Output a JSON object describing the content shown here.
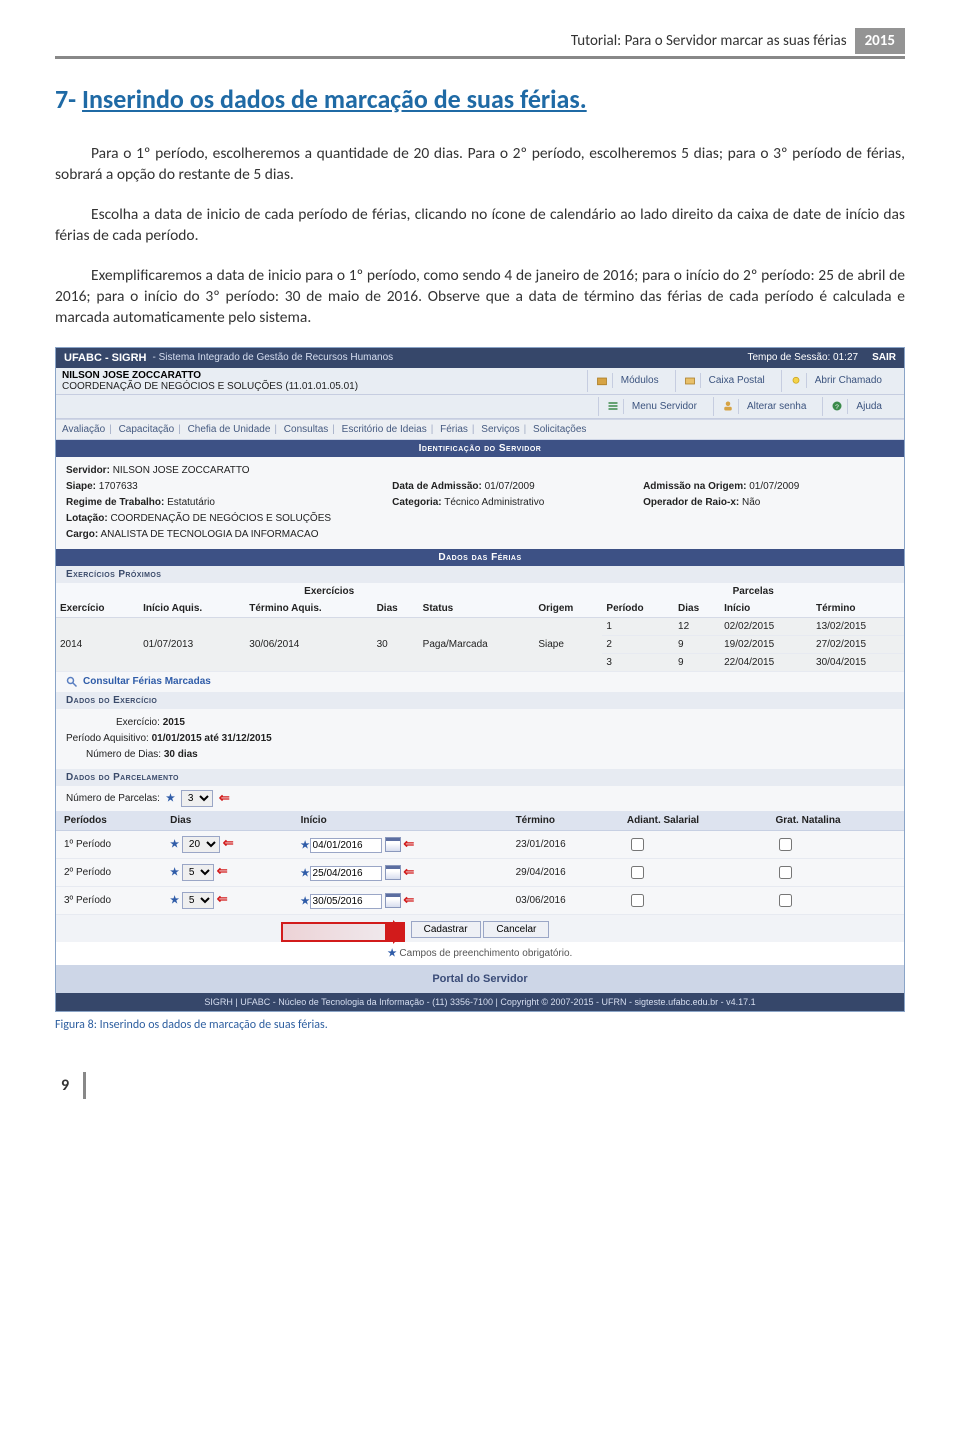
{
  "doc": {
    "header_title": "Tutorial: Para o Servidor marcar as suas férias",
    "header_year": "2015",
    "section_num": "7-",
    "section_title": "Inserindo os dados de marcação de suas férias.",
    "p1": "Para o 1º período, escolheremos a quantidade de 20 dias. Para o 2º período, escolheremos 5 dias; para o 3º período de férias, sobrará a opção do restante de 5 dias.",
    "p2": "Escolha a data de inicio de cada período de férias, clicando no ícone de calendário ao lado direito da caixa de date de início das férias de cada período.",
    "p3": "Exemplificaremos a data de inicio para o 1º período, como sendo 4 de janeiro de 2016; para o início do 2º período: 25 de abril de 2016; para o início do 3º período: 30 de maio de 2016. Observe que a data de término das férias de cada período é calculada e marcada automaticamente pelo sistema.",
    "caption": "Figura 8:  Inserindo os dados de marcação de suas férias.",
    "pagenum": "9"
  },
  "app": {
    "brand": "UFABC - SIGRH",
    "brand_sub": "- Sistema Integrado de Gestão de Recursos Humanos",
    "session": "Tempo de Sessão: 01:27",
    "sair": "SAIR",
    "user_name": "NILSON JOSE ZOCCARATTO",
    "user_unit": "COORDENAÇÃO DE NEGÓCIOS E SOLUÇÕES (11.01.01.05.01)",
    "toplinks": {
      "modulos": "Módulos",
      "caixa": "Caixa Postal",
      "abrir": "Abrir Chamado",
      "menu": "Menu Servidor",
      "alterar": "Alterar senha",
      "ajuda": "Ajuda"
    },
    "menu": {
      "avaliacao": "Avaliação",
      "capac": "Capacitação",
      "chefia": "Chefia de Unidade",
      "consultas": "Consultas",
      "escritorio": "Escritório de Ideias",
      "ferias": "Férias",
      "servicos": "Serviços",
      "solic": "Solicitações"
    },
    "band1": "Identificação do Servidor",
    "ident": {
      "servidor_l": "Servidor:",
      "servidor_v": "NILSON JOSE ZOCCARATTO",
      "siape_l": "Siape:",
      "siape_v": "1707633",
      "adm_l": "Data de Admissão:",
      "adm_v": "01/07/2009",
      "admorig_l": "Admissão na Origem:",
      "admorig_v": "01/07/2009",
      "regime_l": "Regime de Trabalho:",
      "regime_v": "Estatutário",
      "cat_l": "Categoria:",
      "cat_v": "Técnico Administrativo",
      "raio_l": "Operador de Raio-x:",
      "raio_v": "Não",
      "lot_l": "Lotação:",
      "lot_v": "COORDENAÇÃO DE NEGÓCIOS E SOLUÇÕES",
      "cargo_l": "Cargo:",
      "cargo_v": "ANALISTA DE TECNOLOGIA DA INFORMACAO"
    },
    "band2": "Dados das Férias",
    "sub_ex": "Exercícios Próximos",
    "th": {
      "grupo1": "Exercícios",
      "grupo2": "Parcelas",
      "exerc": "Exercício",
      "ini": "Início Aquis.",
      "term": "Término Aquis.",
      "dias": "Dias",
      "status": "Status",
      "origem": "Origem",
      "periodo": "Período",
      "pdias": "Dias",
      "pinicio": "Início",
      "ptermino": "Término"
    },
    "ex2014": {
      "exerc": "2014",
      "ini": "01/07/2013",
      "term": "30/06/2014",
      "dias": "30",
      "status": "Paga/Marcada",
      "origem": "Siape",
      "parc": [
        {
          "p": "1",
          "d": "12",
          "i": "02/02/2015",
          "t": "13/02/2015"
        },
        {
          "p": "2",
          "d": "9",
          "i": "19/02/2015",
          "t": "27/02/2015"
        },
        {
          "p": "3",
          "d": "9",
          "i": "22/04/2015",
          "t": "30/04/2015"
        }
      ]
    },
    "consultar": "Consultar Férias Marcadas",
    "sub_dex": "Dados do Exercício",
    "dex": {
      "ex_l": "Exercício:",
      "ex_v": "2015",
      "paq_l": "Período Aquisitivo:",
      "paq_v": "01/01/2015 até 31/12/2015",
      "nd_l": "Número de Dias:",
      "nd_v": "30 dias"
    },
    "sub_parc": "Dados do Parcelamento",
    "np_l": "Número de Parcelas:",
    "np_v": "3",
    "phead": {
      "periodos": "Períodos",
      "dias": "Dias",
      "inicio": "Início",
      "termino": "Término",
      "adiant": "Adiant. Salarial",
      "grat": "Grat. Natalina"
    },
    "prows": [
      {
        "label": "1º Período",
        "dias": "20",
        "inicio": "04/01/2016",
        "termino": "23/01/2016"
      },
      {
        "label": "2º Período",
        "dias": "5",
        "inicio": "25/04/2016",
        "termino": "29/04/2016"
      },
      {
        "label": "3º Período",
        "dias": "5",
        "inicio": "30/05/2016",
        "termino": "03/06/2016"
      }
    ],
    "btn_cad": "Cadastrar",
    "btn_can": "Cancelar",
    "obrig": "Campos de preenchimento obrigatório.",
    "portal": "Portal do Servidor",
    "footer": "SIGRH | UFABC - Núcleo de Tecnologia da Informação - (11) 3356-7100 | Copyright © 2007-2015 - UFRN - sigteste.ufabc.edu.br - v4.17.1"
  }
}
